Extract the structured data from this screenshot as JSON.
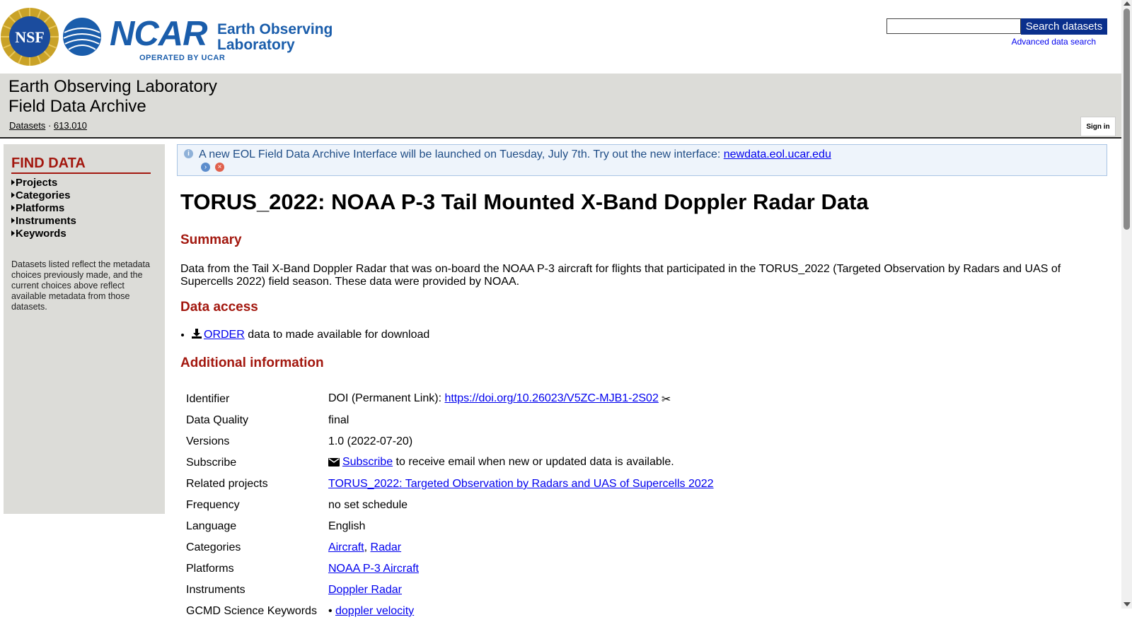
{
  "header": {
    "nsf_logo_text": "NSF",
    "ncar_word": "NCAR",
    "ncar_operated": "OPERATED BY UCAR",
    "eol_line1": "Earth Observing",
    "eol_line2": "Laboratory",
    "search_placeholder": "",
    "search_button": "Search datasets",
    "advanced_search": "Advanced data search",
    "brand_color": "#1a5dab"
  },
  "titleband": {
    "line1": "Earth Observing Laboratory",
    "line2": "Field Data Archive",
    "breadcrumb": [
      "Datasets",
      "613.010"
    ],
    "breadcrumb_sep": "·",
    "sign_in": "Sign in"
  },
  "sidebar": {
    "title": "FIND DATA",
    "items": [
      "Projects",
      "Categories",
      "Platforms",
      "Instruments",
      "Keywords"
    ],
    "note": "Datasets listed reflect the metadata choices previously made, and the current choices above reflect available metadata from those datasets."
  },
  "notice": {
    "text": "A new EOL Field Data Archive Interface will be launched on Tuesday, July 7th. Try out the new interface: ",
    "link": "newdata.eol.ucar.edu"
  },
  "main": {
    "title": "TORUS_2022: NOAA P-3 Tail Mounted X-Band Doppler Radar Data",
    "summary_heading": "Summary",
    "summary_text": "Data from the Tail X-Band Doppler Radar that was on-board the NOAA P-3 aircraft for flights that participated in the TORUS_2022 (Targeted Observation by Radars and UAS of Supercells 2022) field season. These data were provided by NOAA.",
    "access_heading": "Data access",
    "access_link": "ORDER",
    "access_rest": " data to made available for download",
    "info_heading": "Additional information",
    "info": {
      "identifier_label": "Identifier",
      "identifier_prefix": "DOI (Permanent Link): ",
      "identifier_link": "https://doi.org/10.26023/V5ZC-MJB1-2S02",
      "quality_label": "Data Quality",
      "quality_value": "final",
      "versions_label": "Versions",
      "versions_value": "1.0 (2022-07-20)",
      "subscribe_label": "Subscribe",
      "subscribe_link": "Subscribe",
      "subscribe_rest": " to receive email when new or updated data is available.",
      "related_label": "Related projects",
      "related_link": "TORUS_2022: Targeted Observation by Radars and UAS of Supercells 2022",
      "frequency_label": "Frequency",
      "frequency_value": "no set schedule",
      "language_label": "Language",
      "language_value": "English",
      "categories_label": "Categories",
      "categories_links": [
        "Aircraft",
        "Radar"
      ],
      "platforms_label": "Platforms",
      "platforms_link": "NOAA P-3 Aircraft",
      "instruments_label": "Instruments",
      "instruments_link": "Doppler Radar",
      "gcmd_label": "GCMD Science Keywords",
      "gcmd_link": "doppler velocity"
    }
  },
  "colors": {
    "heading_red": "#a3180f",
    "panel_gray": "#dcdcd8",
    "search_button_bg": "#0a2f8c",
    "link_blue": "#0000ee"
  }
}
